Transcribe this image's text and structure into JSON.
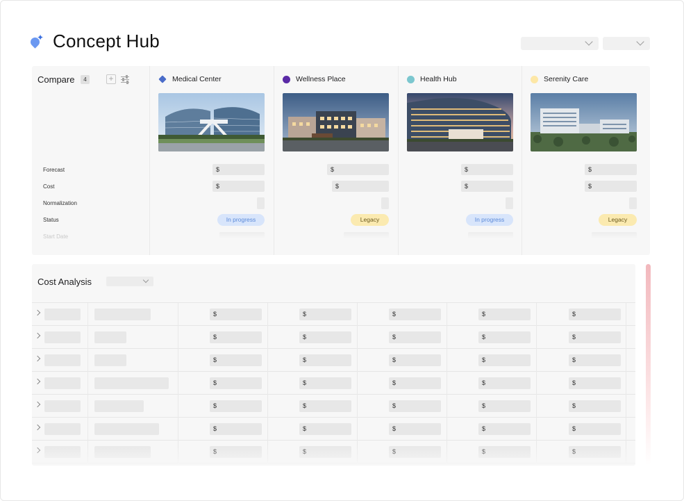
{
  "app": {
    "title": "Concept Hub",
    "logo_icon": "sparkle-drop-icon"
  },
  "compare": {
    "title": "Compare",
    "count": "4",
    "row_labels": [
      "Forecast",
      "Cost",
      "Normalization",
      "Status",
      "Start Date"
    ],
    "columns": [
      {
        "name": "Medical Center",
        "marker": "diamond",
        "color": "#4a6cc9",
        "forecast": "$",
        "cost": "$",
        "status": "In progress",
        "status_kind": "prog"
      },
      {
        "name": "Wellness Place",
        "marker": "circle",
        "color": "#5a2aa6",
        "forecast": "$",
        "cost": "$",
        "status": "Legacy",
        "status_kind": "legacy"
      },
      {
        "name": "Health Hub",
        "marker": "circle",
        "color": "#7cc7cf",
        "forecast": "$",
        "cost": "$",
        "status": "In progress",
        "status_kind": "prog"
      },
      {
        "name": "Serenity Care",
        "marker": "circle",
        "color": "#fde7a6",
        "forecast": "$",
        "cost": "$",
        "status": "Legacy",
        "status_kind": "legacy"
      }
    ]
  },
  "cost_analysis": {
    "title": "Cost Analysis",
    "currency": "$",
    "rows": 7
  }
}
